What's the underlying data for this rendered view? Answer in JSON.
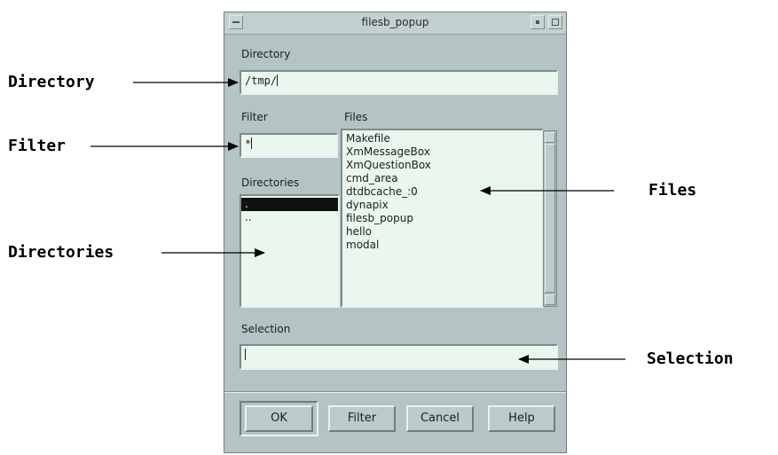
{
  "window": {
    "title": "filesb_popup"
  },
  "dialog": {
    "directory_label": "Directory",
    "directory_value": "/tmp/",
    "filter_label": "Filter",
    "filter_value": "*",
    "files_label": "Files",
    "directories_label": "Directories",
    "selection_label": "Selection",
    "selection_value": "",
    "directories": [
      ".",
      ".."
    ],
    "selected_directory_index": 0,
    "files": [
      "Makefile",
      "XmMessageBox",
      "XmQuestionBox",
      "cmd_area",
      "dtdbcache_:0",
      "dynapix",
      "filesb_popup",
      "hello",
      "modal"
    ],
    "buttons": {
      "ok": "OK",
      "filter": "Filter",
      "cancel": "Cancel",
      "help": "Help"
    }
  },
  "callouts": {
    "directory": "Directory",
    "filter": "Filter",
    "directories": "Directories",
    "files": "Files",
    "selection": "Selection"
  },
  "colors": {
    "window_bg": "#b4c3c3",
    "field_bg": "#eaf6ee",
    "selected_row_bg": "#111111"
  }
}
